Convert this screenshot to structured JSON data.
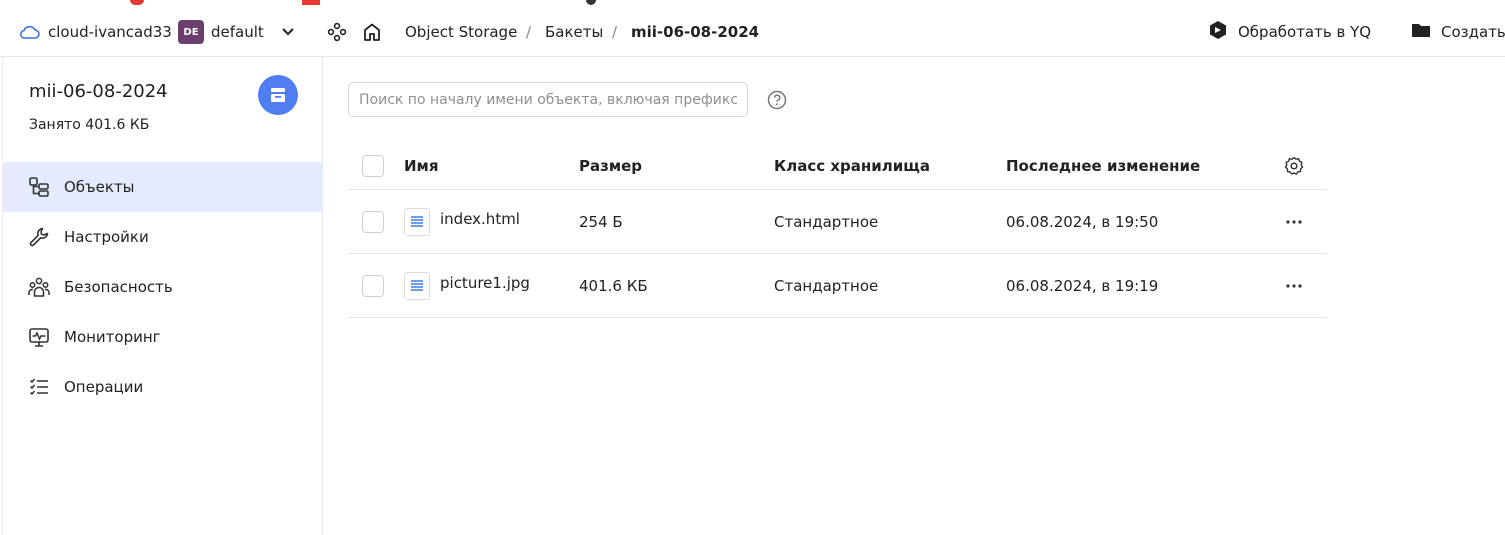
{
  "header": {
    "cloud_name": "cloud-ivancad33",
    "folder_badge": "DE",
    "folder_name": "default",
    "breadcrumbs": [
      "Object Storage",
      "Бакеты",
      "mii-06-08-2024"
    ],
    "separator": "/",
    "yq_button": "Обработать в YQ",
    "create_button": "Создать"
  },
  "sidebar": {
    "bucket_name": "mii-06-08-2024",
    "used": "Занято 401.6 КБ",
    "items": [
      {
        "label": "Объекты",
        "icon": "objects-icon",
        "active": true
      },
      {
        "label": "Настройки",
        "icon": "wrench-icon",
        "active": false
      },
      {
        "label": "Безопасность",
        "icon": "users-icon",
        "active": false
      },
      {
        "label": "Мониторинг",
        "icon": "monitor-icon",
        "active": false
      },
      {
        "label": "Операции",
        "icon": "list-icon",
        "active": false
      }
    ]
  },
  "main": {
    "search_placeholder": "Поиск по началу имени объекта, включая префикс",
    "columns": [
      "Имя",
      "Размер",
      "Класс хранилища",
      "Последнее изменение"
    ],
    "rows": [
      {
        "name": "index.html",
        "size": "254 Б",
        "storage_class": "Стандартное",
        "modified": "06.08.2024, в 19:50"
      },
      {
        "name": "picture1.jpg",
        "size": "401.6 КБ",
        "storage_class": "Стандартное",
        "modified": "06.08.2024, в 19:19"
      }
    ]
  },
  "colors": {
    "accent": "#4f7ef2",
    "active_bg": "#e5ebfc",
    "badge": "#6b3f6d",
    "file_icon": "#3b7ddd"
  }
}
